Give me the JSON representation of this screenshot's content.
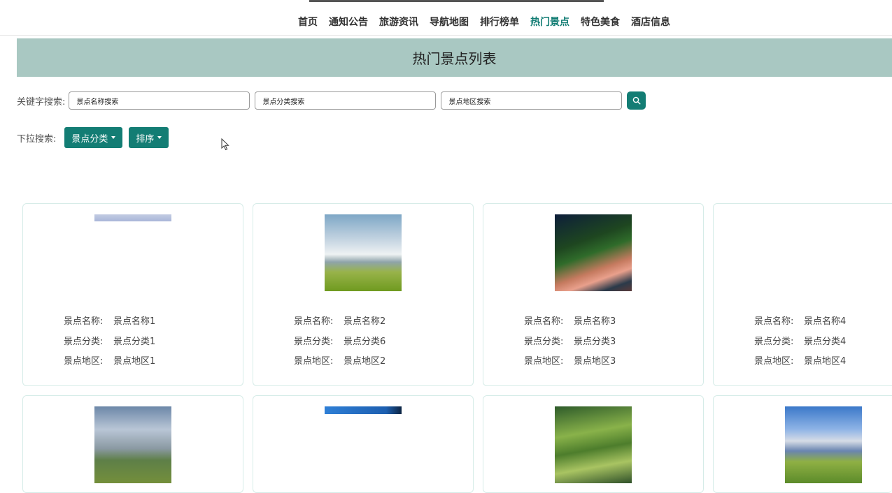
{
  "nav": {
    "items": [
      "首页",
      "通知公告",
      "旅游资讯",
      "导航地图",
      "排行榜单",
      "热门景点",
      "特色美食",
      "酒店信息"
    ],
    "active_index": 5,
    "active_color": "#137d74"
  },
  "banner": {
    "title": "热门景点列表",
    "color": "#a9c8c2"
  },
  "search": {
    "label": "关键字搜索:",
    "name_value": "景点名称搜索",
    "category_value": "景点分类搜索",
    "region_value": "景点地区搜索",
    "button_icon": "search-icon"
  },
  "filter": {
    "label": "下拉搜索:",
    "category_button": "景点分类",
    "sort_button": "排序"
  },
  "field_labels": {
    "name": "景点名称:",
    "category": "景点分类:",
    "region": "景点地区:"
  },
  "cards": [
    {
      "name": "景点名称1",
      "category": "景点分类1",
      "region": "景点地区1"
    },
    {
      "name": "景点名称2",
      "category": "景点分类6",
      "region": "景点地区2"
    },
    {
      "name": "景点名称3",
      "category": "景点分类3",
      "region": "景点地区3"
    },
    {
      "name": "景点名称4",
      "category": "景点分类4",
      "region": "景点地区4"
    }
  ],
  "theme": {
    "accent": "#137d74",
    "card_border": "#d6ece8"
  }
}
